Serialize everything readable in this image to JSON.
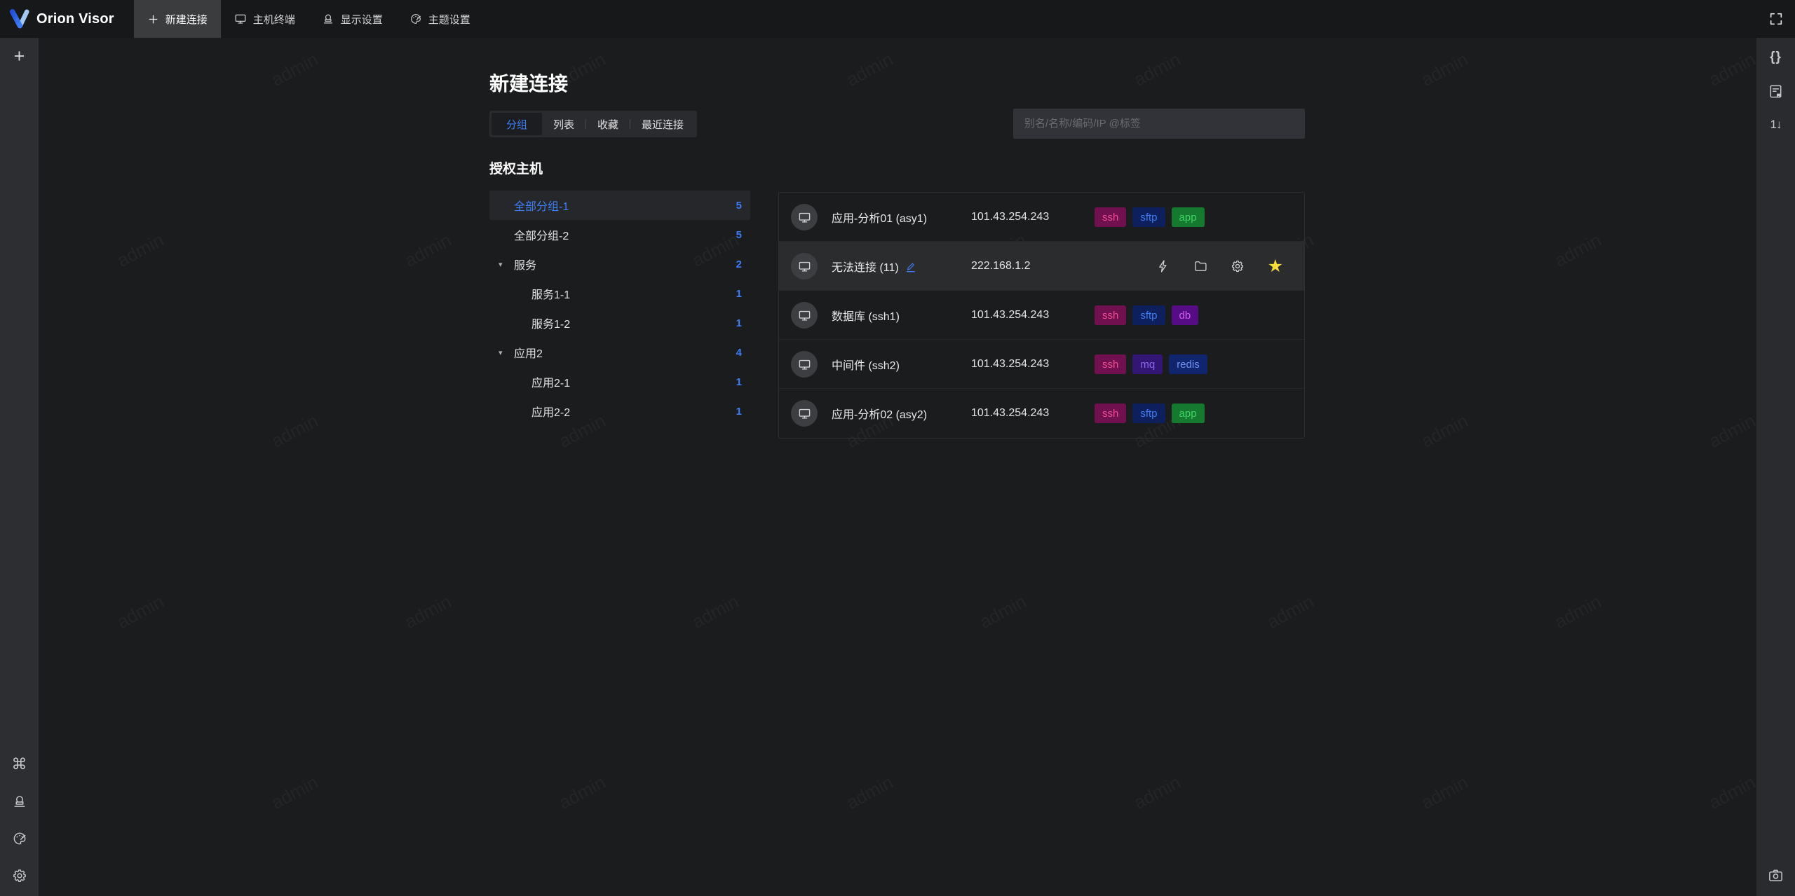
{
  "app": {
    "name": "Orion Visor"
  },
  "colors": {
    "accent_blue": "#3d7ef5",
    "topbar_bg": "#17181a",
    "active_top_tab_bg": "#3b3c3e",
    "left_rail_bg": "#2d2e31",
    "right_rail_bg": "#2a2b2e",
    "main_bg": "#1b1c1d",
    "hover_row_bg": "#2b2c2e",
    "star_yellow": "#f6dc3a",
    "edit_blue": "#3e7bf0"
  },
  "icons": {
    "plus_glyph": "+",
    "command_glyph": "⌘",
    "braces_glyph": "{}",
    "sort_numeric_glyph": "1↓",
    "caret_down_glyph": "▾",
    "star_glyph": "★"
  },
  "topbar": {
    "tabs": [
      {
        "label": "新建连接"
      },
      {
        "label": "主机终端"
      },
      {
        "label": "显示设置"
      },
      {
        "label": "主题设置"
      }
    ],
    "active_tab": "新建连接"
  },
  "page": {
    "title": "新建连接"
  },
  "view_tabs": {
    "active": "分组",
    "items": [
      {
        "label": "分组"
      },
      {
        "label": "列表"
      },
      {
        "label": "收藏"
      },
      {
        "label": "最近连接"
      }
    ]
  },
  "search": {
    "placeholder": "别名/名称/编码/IP @标签"
  },
  "tree": {
    "heading": "授权主机",
    "items": [
      {
        "label": "全部分组-1",
        "count": "5"
      },
      {
        "label": "全部分组-2",
        "count": "5"
      },
      {
        "label": "服务",
        "count": "2"
      },
      {
        "label": "服务1-1",
        "count": "1"
      },
      {
        "label": "服务1-2",
        "count": "1"
      },
      {
        "label": "应用2",
        "count": "4"
      },
      {
        "label": "应用2-1",
        "count": "1"
      },
      {
        "label": "应用2-2",
        "count": "1"
      }
    ],
    "selected_item": "全部分组-1"
  },
  "hosts": {
    "rows": [
      {
        "name": "应用-分析01 (asy1)",
        "ip": "101.43.254.243",
        "tags": [
          "ssh",
          "sftp",
          "app"
        ]
      },
      {
        "name": "无法连接 (11)",
        "ip": "222.168.1.2",
        "tags": []
      },
      {
        "name": "数据库 (ssh1)",
        "ip": "101.43.254.243",
        "tags": [
          "ssh",
          "sftp",
          "db"
        ]
      },
      {
        "name": "中间件 (ssh2)",
        "ip": "101.43.254.243",
        "tags": [
          "ssh",
          "mq",
          "redis"
        ]
      },
      {
        "name": "应用-分析02 (asy2)",
        "ip": "101.43.254.243",
        "tags": [
          "ssh",
          "sftp",
          "app"
        ]
      }
    ]
  },
  "tag_colors": {
    "ssh": {
      "bg": "#70104e",
      "fg": "#f14d94"
    },
    "sftp": {
      "bg": "#0e1f5e",
      "fg": "#3f7df0"
    },
    "app": {
      "bg": "#157a30",
      "fg": "#3bd463"
    },
    "db": {
      "bg": "#560c85",
      "fg": "#d05df2"
    },
    "mq": {
      "bg": "#331573",
      "fg": "#8b66f2"
    },
    "redis": {
      "bg": "#11246e",
      "fg": "#6e93f5"
    }
  },
  "watermark": {
    "text": "admin"
  }
}
